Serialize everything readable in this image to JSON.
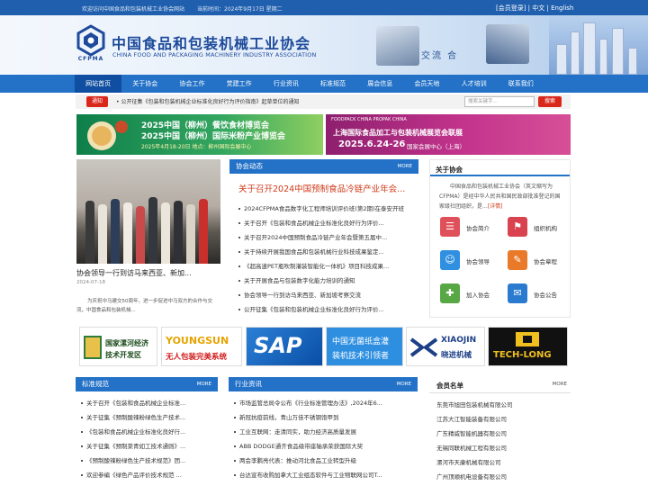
{
  "topbar": {
    "welcome": "欢迎访问中国食品和包装机械工业协会网站",
    "date": "当前时间：2024年9月17日 星期二",
    "links": "[会员登录] | 中文 | English"
  },
  "header": {
    "logo_en": "CFPMA",
    "name_cn": "中国食品和包装机械工业协会",
    "name_en": "CHINA FOOD AND PACKAGING MACHINERY INDUSTRY ASSOCIATION",
    "slogan": "交流 合"
  },
  "nav": [
    "网站首页",
    "关于协会",
    "协会工作",
    "党建工作",
    "行业资讯",
    "标准规范",
    "展会信息",
    "会员天地",
    "人才培训",
    "联系我们"
  ],
  "search": {
    "tag": "通知",
    "news": "• 公开征集《包装和包装机械企业标准化良好行为评价指南》起草单位的通知",
    "placeholder": "搜索关键字...",
    "button": "搜索"
  },
  "banners": {
    "left": {
      "line1": "2025中国（柳州）餐饮食材博览会",
      "line2": "2025中国（柳州）国际米粉产业博览会",
      "line3": "2025年4月18-20日    地点：柳州国际会展中心"
    },
    "right": {
      "brands": "FOODPACK CHINA  PROPAK CHINA",
      "line1": "上海国际食品加工与包装机械展览会联展",
      "line2": "2025.6.24-26",
      "line3": "国家会展中心（上海）"
    }
  },
  "feature": {
    "title": "协会领导一行到访马来西亚、新加...",
    "date": "2024-07-18",
    "desc": "为庆祝中马建交50周年，进一步促进中马双方的合作与交流，中国食品和包装机械..."
  },
  "association_news": {
    "title": "协会动态",
    "more": "MORE",
    "headline": "关于召开2024中国预制食品冷链产业年会...",
    "items": [
      "2024CFPMA食品数字化工程师培训评价班(第2期)在泰安开班",
      "关于召开《包装和食品机械企业标准化良好行为评价...",
      "关于召开2024中国预制食品冷链产业年会暨第五届中...",
      "关于持续开展我国食品和包装机械行业科技成果鉴定...",
      "《超高速PET瓶吹制灌装智能化一体机》项目科技成果...",
      "关于开展食品与包装数字化能力培训的通知",
      "协会领导一行到访马来西亚、新加坡考察交流",
      "公开征集《包装和包装机械企业标准化良好行为评价..."
    ]
  },
  "about": {
    "title": "关于协会",
    "text": "中国食品和包装机械工业协会（英文缩写为CFPMA）是经中华人民共和国民政部批准登记的国家级社团组织，是...",
    "more": "[详情]",
    "items": [
      {
        "label": "协会简介",
        "icon": "info-icon",
        "color": "#e0505b"
      },
      {
        "label": "组织机构",
        "icon": "org-icon",
        "color": "#d9434f"
      },
      {
        "label": "协会领导",
        "icon": "people-icon",
        "color": "#2f8fe0"
      },
      {
        "label": "协会章程",
        "icon": "doc-icon",
        "color": "#e97a2a"
      },
      {
        "label": "加入协会",
        "icon": "join-icon",
        "color": "#57a845"
      },
      {
        "label": "协会公告",
        "icon": "notice-icon",
        "color": "#2a7bd0"
      }
    ]
  },
  "partners": [
    {
      "name": "国家漯河经济技术开发区",
      "line1": "国家漯河经济",
      "line2": "技术开发区"
    },
    {
      "name": "YOUNGSUN 无人包装完美系统",
      "line1": "YOUNGSUN",
      "line2": "无人包装完美系统"
    },
    {
      "name": "SAP",
      "line1": "SAP",
      "line2": ""
    },
    {
      "name": "中国无菌纸盒灌装机技术引领者",
      "line1": "中国无菌纸盒灌",
      "line2": "装机技术引领者"
    },
    {
      "name": "XIAOJIN 晓进机械",
      "line1": "XIAOJIN",
      "line2": "晓进机械"
    },
    {
      "name": "TECH-LONG",
      "line1": "TECH-LONG",
      "line2": ""
    }
  ],
  "standards": {
    "title": "标准规范",
    "more": "MORE",
    "items": [
      "关于召开《包装和食品机械企业标准...",
      "关于征集《预制酸辣粉绿色生产技术...",
      "《包装和食品机械企业标准化良好行...",
      "关于征集《预制菜青如工技术通则》...",
      "《预制酸辣粉绿色生产技术规范》团...",
      "欢迎参编《绿色产品评价技术规范 ..."
    ]
  },
  "industry_news": {
    "title": "行业资讯",
    "more": "MORE",
    "items": [
      "市场监管总局令公布《行业标准管理办法》,2024年6...",
      "新冠抗疫前线，青山万佳不锈钢饱甲到",
      "工业互联网：走清同实，助力经济高质量发展",
      "ABB DODGE通齐食品级带座轴承荣获国际大奖",
      "两会李鹏亮代表：推动河北食品工业转型升级",
      "台达宣布收购加拿大工业组态软件与工业物联网公司T..."
    ]
  },
  "members": {
    "title": "会员名单",
    "more": "MORE",
    "items": [
      "东莞市旭田包装机械有限公司",
      "江苏大江智能装备有限公司",
      "广东精威智能机器有限公司",
      "无锡同联机械工程有限公司",
      "漯河市天康机械有限公司",
      "广州顶顺机电设备有限公司"
    ]
  }
}
